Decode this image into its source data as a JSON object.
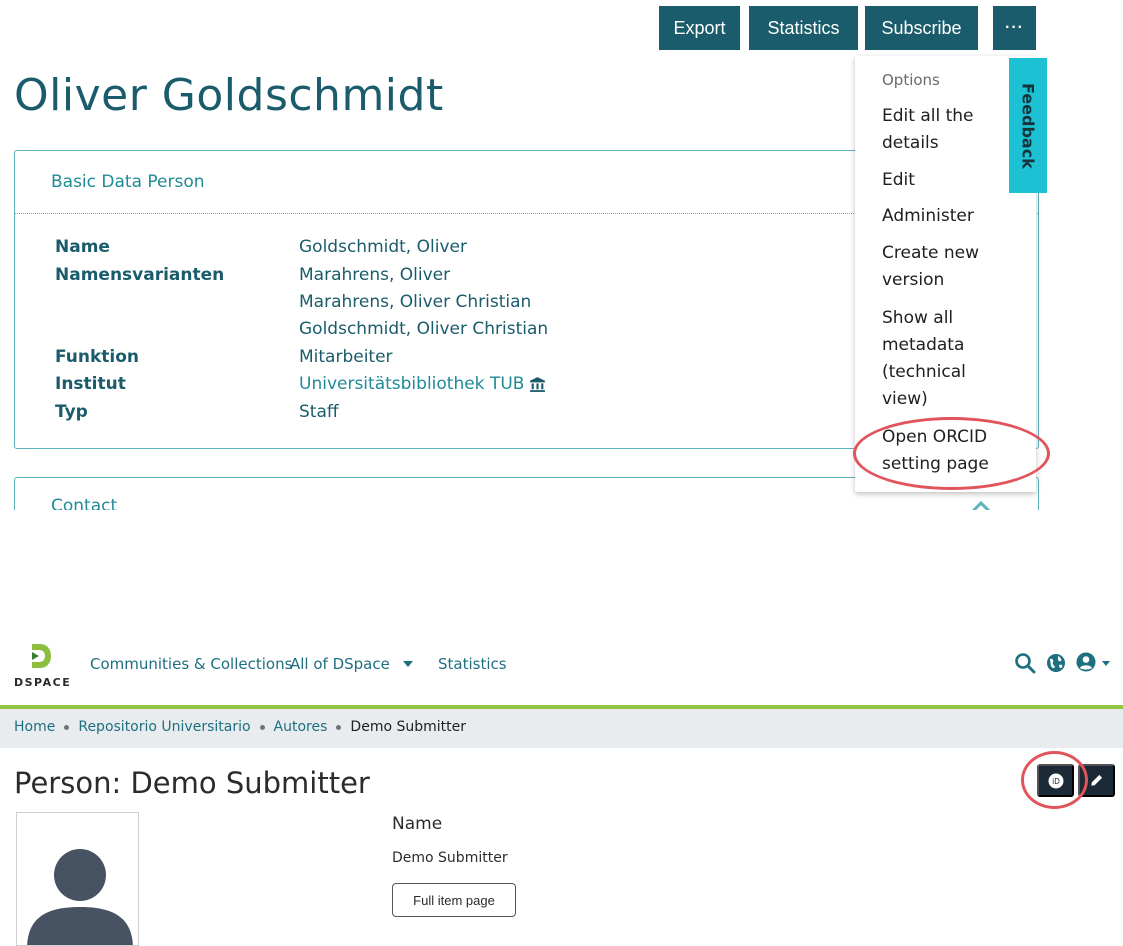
{
  "top": {
    "toolbar": {
      "export_label": "Export",
      "statistics_label": "Statistics",
      "subscribe_label": "Subscribe",
      "more_label": "···"
    },
    "person_name": "Oliver Goldschmidt",
    "basic_card": {
      "title": "Basic Data Person",
      "fields": {
        "name_label": "Name",
        "name_value": "Goldschmidt, Oliver",
        "variants_label": "Namensvarianten",
        "variants": [
          "Marahrens, Oliver",
          "Marahrens, Oliver Christian",
          "Goldschmidt, Oliver Christian"
        ],
        "function_label": "Funktion",
        "function_value": "Mitarbeiter",
        "institute_label": "Institut",
        "institute_value": "Universitätsbibliothek TUB",
        "type_label": "Typ",
        "type_value": "Staff"
      }
    },
    "contact_card": {
      "title": "Contact"
    },
    "dropdown": {
      "header": "Options",
      "items": [
        "Edit all the details",
        "Edit",
        "Administer",
        "Create new version",
        "Show all metadata (technical view)",
        "Open ORCID setting page"
      ]
    },
    "feedback_label": "Feedback",
    "colors": {
      "primary": "#1a5c6b",
      "link": "#1f8b96",
      "feedback": "#1cc2d4",
      "highlight": "#e2545b"
    }
  },
  "bottom": {
    "logo_text": "DSPACE",
    "nav": {
      "communities": "Communities & Collections",
      "all_of_dspace": "All of DSpace",
      "statistics": "Statistics"
    },
    "breadcrumb": {
      "home": "Home",
      "repo": "Repositorio Universitario",
      "authors": "Autores",
      "current": "Demo Submitter"
    },
    "heading": "Person: Demo Submitter",
    "name_label": "Name",
    "name_value": "Demo Submitter",
    "full_item_label": "Full item page",
    "orcid_badge": "iD",
    "colors": {
      "accent": "#92c642",
      "nav": "#1e6f80",
      "dark_button": "#1b2a36"
    }
  }
}
